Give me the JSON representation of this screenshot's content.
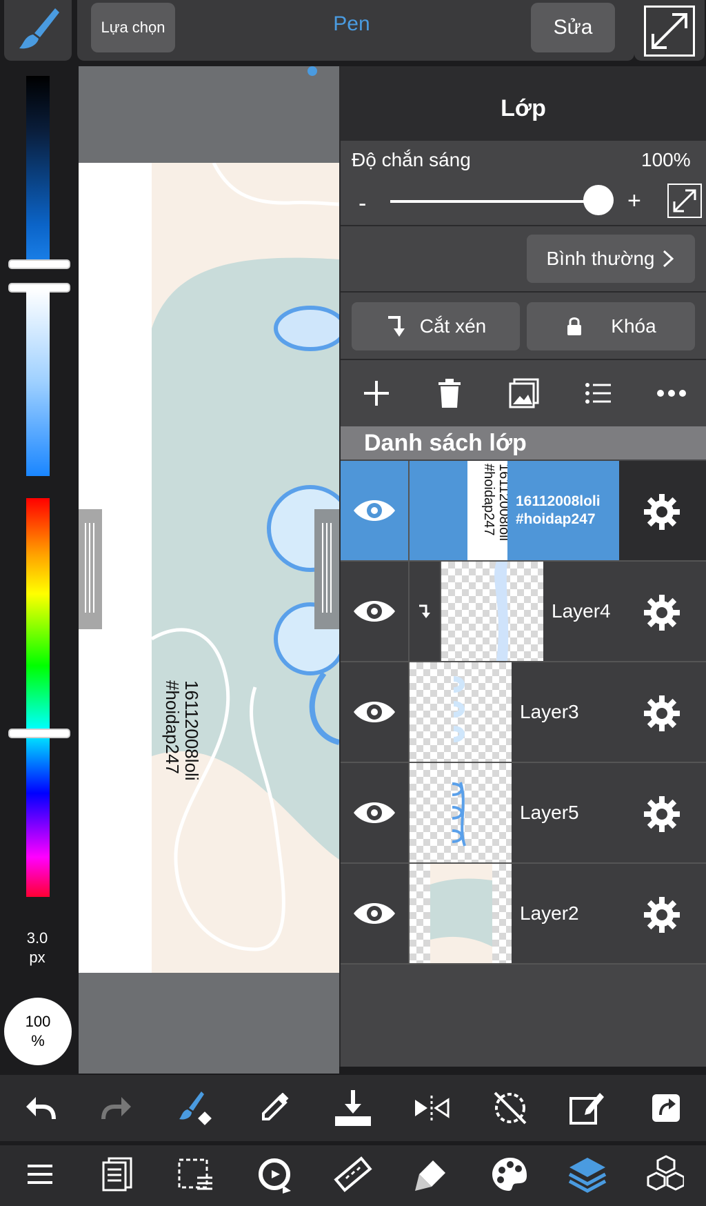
{
  "topbar": {
    "selection_label": "Lựa chọn",
    "tool_title": "Pen",
    "edit_label": "Sửa"
  },
  "left_panel": {
    "brush_size_value": "3.0",
    "brush_size_unit": "px",
    "opacity_value": "100",
    "opacity_unit": "%"
  },
  "layer_panel": {
    "title": "Lớp",
    "opacity_label": "Độ chắn sáng",
    "opacity_value": "100%",
    "opacity_level": 1.0,
    "minus": "-",
    "plus": "+",
    "blend_mode": "Bình thường",
    "clip_label": "Cắt xén",
    "lock_label": "Khóa",
    "list_header": "Danh sách lớp",
    "layers": [
      {
        "name": "16112008loli\n#hoidap247",
        "selected": true
      },
      {
        "name": "Layer4",
        "clipped": true
      },
      {
        "name": "Layer3"
      },
      {
        "name": "Layer5"
      },
      {
        "name": "Layer2"
      }
    ]
  },
  "canvas": {
    "watermark_line1": "16112008loli",
    "watermark_line2": "#hoidap247"
  },
  "colors": {
    "accent": "#4a9be0",
    "selected_layer": "#4f96d8",
    "panel_bg": "#454547"
  }
}
